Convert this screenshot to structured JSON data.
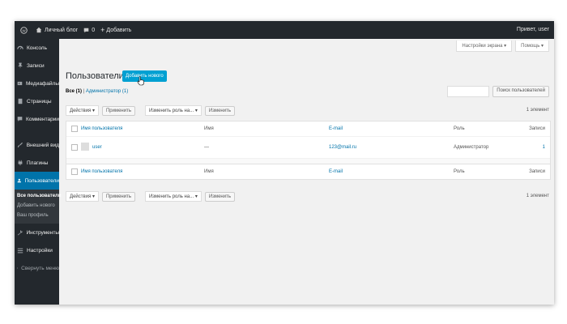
{
  "adminbar": {
    "site_name": "Личный блог",
    "comments_count": "0",
    "add_new": "Добавить",
    "howdy": "Привет, user"
  },
  "sidebar": {
    "items": [
      {
        "label": "Консоль",
        "icon": "dashboard-icon"
      },
      {
        "label": "Записи",
        "icon": "pin-icon"
      },
      {
        "label": "Медиафайлы",
        "icon": "media-icon"
      },
      {
        "label": "Страницы",
        "icon": "page-icon"
      },
      {
        "label": "Комментарии",
        "icon": "comment-icon"
      },
      {
        "label": "Внешний вид",
        "icon": "brush-icon"
      },
      {
        "label": "Плагины",
        "icon": "plugin-icon"
      },
      {
        "label": "Пользователи",
        "icon": "users-icon"
      },
      {
        "label": "Инструменты",
        "icon": "wrench-icon"
      },
      {
        "label": "Настройки",
        "icon": "settings-icon"
      },
      {
        "label": "Свернуть меню",
        "icon": "collapse-icon"
      }
    ],
    "submenu": [
      "Все пользователи",
      "Добавить нового",
      "Ваш профиль"
    ]
  },
  "screen_meta": {
    "options": "Настройки экрана ▾",
    "help": "Помощь ▾"
  },
  "page": {
    "title": "Пользователи",
    "add_new": "Добавить нового",
    "filter_all": "Все (1)",
    "filter_sep": " | ",
    "filter_admin": "Администратор (1)",
    "search_button": "Поиск пользователей",
    "item_count": "1 элемент"
  },
  "tablenav": {
    "bulk_actions": "Действия ▾",
    "apply": "Применить",
    "change_role": "Изменить роль на... ▾",
    "change": "Изменить"
  },
  "table": {
    "columns": [
      "Имя пользователя",
      "Имя",
      "E-mail",
      "Роль",
      "Записи"
    ],
    "rows": [
      {
        "username": "user",
        "name": "—",
        "email": "123@mail.ru",
        "role": "Администратор",
        "posts": "1"
      }
    ]
  },
  "colors": {
    "adminbar": "#23282d",
    "accent": "#0073aa",
    "button": "#00a0d2"
  }
}
